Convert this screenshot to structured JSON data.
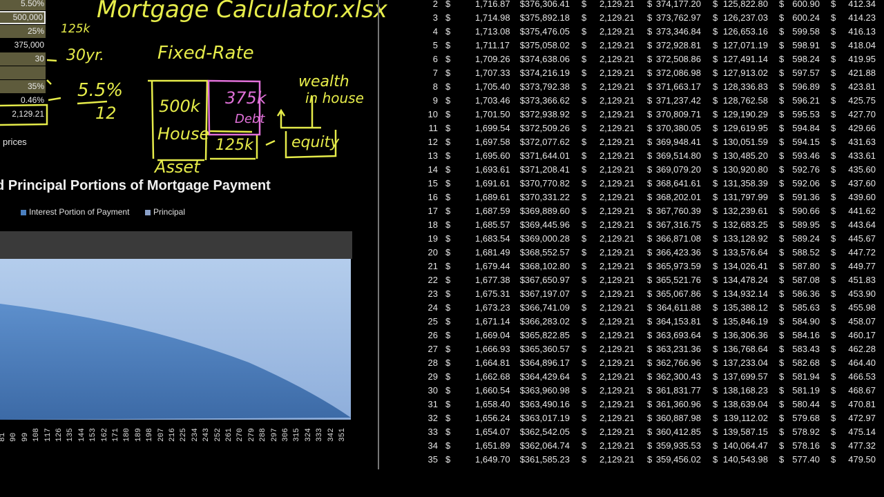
{
  "inputs": [
    {
      "value": "5.50%",
      "style": "olive"
    },
    {
      "value": "500,000",
      "style": "selected"
    },
    {
      "value": "25%",
      "style": "olive"
    },
    {
      "value": "375,000",
      "style": "plain"
    },
    {
      "value": "30",
      "style": "olive"
    },
    {
      "value": "",
      "style": "olive"
    },
    {
      "value": "35%",
      "style": "olive"
    }
  ],
  "monthly_rate": "0.46%",
  "monthly_payment": "2,129.21",
  "prices_label": "prices",
  "annotations": {
    "title": "Mortgage Calculator.xlsx",
    "down": "125k",
    "term": "30yr.",
    "fixed": "Fixed-Rate",
    "rate_num": "5.5%",
    "rate_den": "12",
    "house": "500k",
    "house2": "House",
    "debt": "375k",
    "debt2": "Debt",
    "equity_amt": "125k",
    "asset": "Asset",
    "wealth": "wealth",
    "wealth2": "in house",
    "equity": "equity"
  },
  "chart_data": {
    "type": "area",
    "title": "Interest and Principal Portions of Mortgage Payment",
    "title_visible": "d Principal Portions of Mortgage Payment",
    "legend": [
      "Interest Portion of Payment",
      "Principal"
    ],
    "legend_placement": "top",
    "colors": {
      "interest": "#4a7fbf",
      "principal": "#a9c4e6",
      "band": "#3a3a3a"
    },
    "x_ticks": [
      "81",
      "90",
      "99",
      "108",
      "117",
      "126",
      "135",
      "144",
      "153",
      "162",
      "171",
      "180",
      "189",
      "198",
      "207",
      "216",
      "225",
      "234",
      "243",
      "252",
      "261",
      "270",
      "279",
      "288",
      "297",
      "306",
      "315",
      "324",
      "333",
      "342",
      "351"
    ]
  },
  "table": {
    "currency": "$",
    "rows": [
      [
        "2",
        "1,716.87",
        "$376,306.41",
        "2,129.21",
        "374,177.20",
        "125,822.80",
        "600.90",
        "412.34"
      ],
      [
        "3",
        "1,714.98",
        "$375,892.18",
        "2,129.21",
        "373,762.97",
        "126,237.03",
        "600.24",
        "414.23"
      ],
      [
        "4",
        "1,713.08",
        "$375,476.05",
        "2,129.21",
        "373,346.84",
        "126,653.16",
        "599.58",
        "416.13"
      ],
      [
        "5",
        "1,711.17",
        "$375,058.02",
        "2,129.21",
        "372,928.81",
        "127,071.19",
        "598.91",
        "418.04"
      ],
      [
        "6",
        "1,709.26",
        "$374,638.06",
        "2,129.21",
        "372,508.86",
        "127,491.14",
        "598.24",
        "419.95"
      ],
      [
        "7",
        "1,707.33",
        "$374,216.19",
        "2,129.21",
        "372,086.98",
        "127,913.02",
        "597.57",
        "421.88"
      ],
      [
        "8",
        "1,705.40",
        "$373,792.38",
        "2,129.21",
        "371,663.17",
        "128,336.83",
        "596.89",
        "423.81"
      ],
      [
        "9",
        "1,703.46",
        "$373,366.62",
        "2,129.21",
        "371,237.42",
        "128,762.58",
        "596.21",
        "425.75"
      ],
      [
        "10",
        "1,701.50",
        "$372,938.92",
        "2,129.21",
        "370,809.71",
        "129,190.29",
        "595.53",
        "427.70"
      ],
      [
        "11",
        "1,699.54",
        "$372,509.26",
        "2,129.21",
        "370,380.05",
        "129,619.95",
        "594.84",
        "429.66"
      ],
      [
        "12",
        "1,697.58",
        "$372,077.62",
        "2,129.21",
        "369,948.41",
        "130,051.59",
        "594.15",
        "431.63"
      ],
      [
        "13",
        "1,695.60",
        "$371,644.01",
        "2,129.21",
        "369,514.80",
        "130,485.20",
        "593.46",
        "433.61"
      ],
      [
        "14",
        "1,693.61",
        "$371,208.41",
        "2,129.21",
        "369,079.20",
        "130,920.80",
        "592.76",
        "435.60"
      ],
      [
        "15",
        "1,691.61",
        "$370,770.82",
        "2,129.21",
        "368,641.61",
        "131,358.39",
        "592.06",
        "437.60"
      ],
      [
        "16",
        "1,689.61",
        "$370,331.22",
        "2,129.21",
        "368,202.01",
        "131,797.99",
        "591.36",
        "439.60"
      ],
      [
        "17",
        "1,687.59",
        "$369,889.60",
        "2,129.21",
        "367,760.39",
        "132,239.61",
        "590.66",
        "441.62"
      ],
      [
        "18",
        "1,685.57",
        "$369,445.96",
        "2,129.21",
        "367,316.75",
        "132,683.25",
        "589.95",
        "443.64"
      ],
      [
        "19",
        "1,683.54",
        "$369,000.28",
        "2,129.21",
        "366,871.08",
        "133,128.92",
        "589.24",
        "445.67"
      ],
      [
        "20",
        "1,681.49",
        "$368,552.57",
        "2,129.21",
        "366,423.36",
        "133,576.64",
        "588.52",
        "447.72"
      ],
      [
        "21",
        "1,679.44",
        "$368,102.80",
        "2,129.21",
        "365,973.59",
        "134,026.41",
        "587.80",
        "449.77"
      ],
      [
        "22",
        "1,677.38",
        "$367,650.97",
        "2,129.21",
        "365,521.76",
        "134,478.24",
        "587.08",
        "451.83"
      ],
      [
        "23",
        "1,675.31",
        "$367,197.07",
        "2,129.21",
        "365,067.86",
        "134,932.14",
        "586.36",
        "453.90"
      ],
      [
        "24",
        "1,673.23",
        "$366,741.09",
        "2,129.21",
        "364,611.88",
        "135,388.12",
        "585.63",
        "455.98"
      ],
      [
        "25",
        "1,671.14",
        "$366,283.02",
        "2,129.21",
        "364,153.81",
        "135,846.19",
        "584.90",
        "458.07"
      ],
      [
        "26",
        "1,669.04",
        "$365,822.85",
        "2,129.21",
        "363,693.64",
        "136,306.36",
        "584.16",
        "460.17"
      ],
      [
        "27",
        "1,666.93",
        "$365,360.57",
        "2,129.21",
        "363,231.36",
        "136,768.64",
        "583.43",
        "462.28"
      ],
      [
        "28",
        "1,664.81",
        "$364,896.17",
        "2,129.21",
        "362,766.96",
        "137,233.04",
        "582.68",
        "464.40"
      ],
      [
        "29",
        "1,662.68",
        "$364,429.64",
        "2,129.21",
        "362,300.43",
        "137,699.57",
        "581.94",
        "466.53"
      ],
      [
        "30",
        "1,660.54",
        "$363,960.98",
        "2,129.21",
        "361,831.77",
        "138,168.23",
        "581.19",
        "468.67"
      ],
      [
        "31",
        "1,658.40",
        "$363,490.16",
        "2,129.21",
        "361,360.96",
        "138,639.04",
        "580.44",
        "470.81"
      ],
      [
        "32",
        "1,656.24",
        "$363,017.19",
        "2,129.21",
        "360,887.98",
        "139,112.02",
        "579.68",
        "472.97"
      ],
      [
        "33",
        "1,654.07",
        "$362,542.05",
        "2,129.21",
        "360,412.85",
        "139,587.15",
        "578.92",
        "475.14"
      ],
      [
        "34",
        "1,651.89",
        "$362,064.74",
        "2,129.21",
        "359,935.53",
        "140,064.47",
        "578.16",
        "477.32"
      ],
      [
        "35",
        "1,649.70",
        "$361,585.23",
        "2,129.21",
        "359,456.02",
        "140,543.98",
        "577.40",
        "479.50"
      ]
    ]
  }
}
